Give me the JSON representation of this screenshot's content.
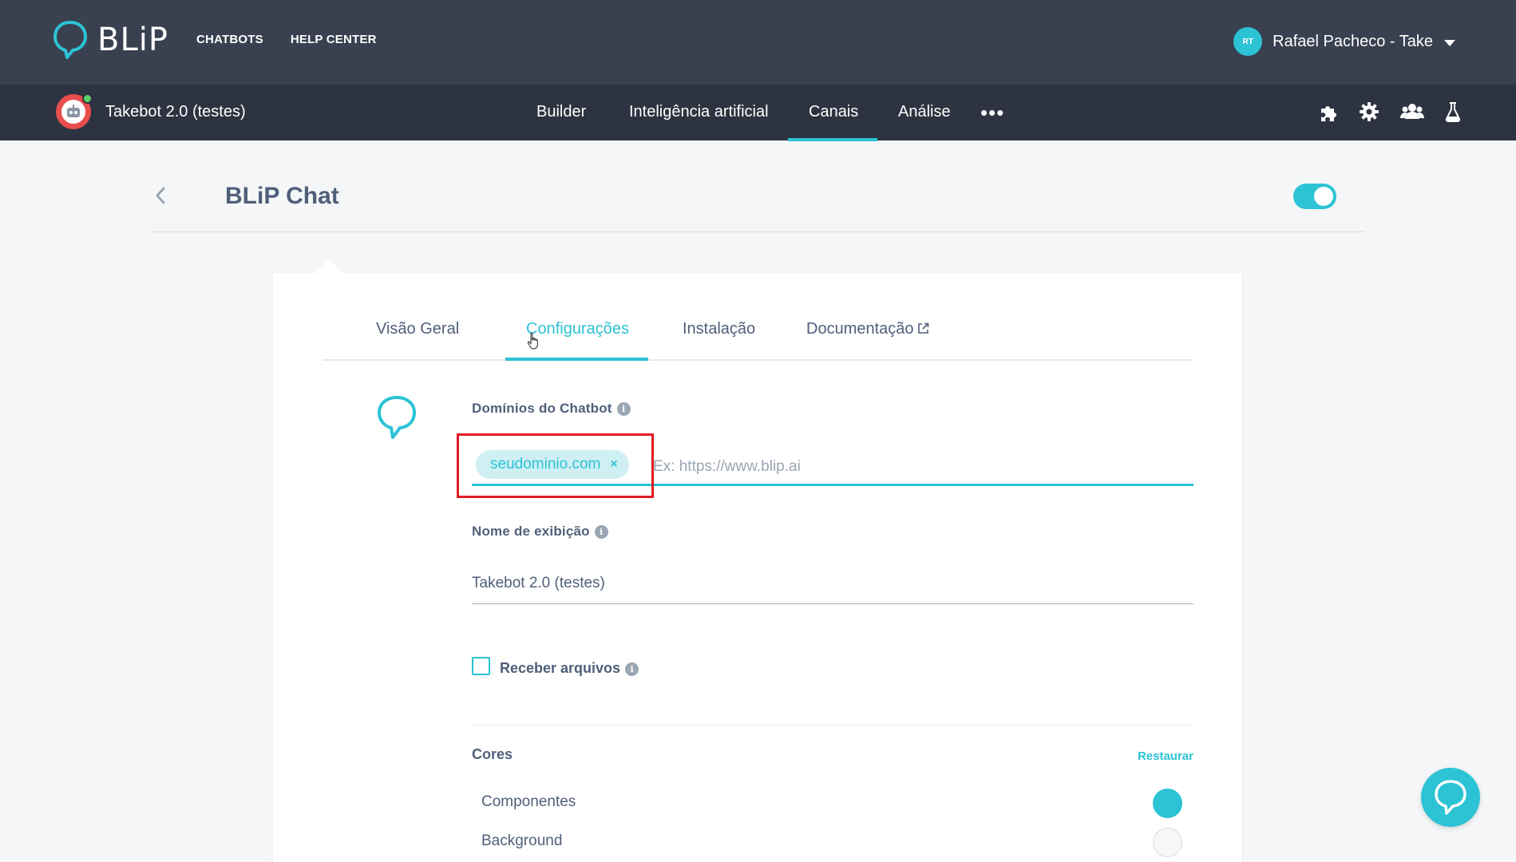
{
  "app": {
    "brand": "BLiP",
    "top_nav": [
      "CHATBOTS",
      "HELP CENTER"
    ],
    "user": {
      "initials": "RT",
      "name": "Rafael Pacheco - Take"
    }
  },
  "bot": {
    "name": "Takebot 2.0 (testes)",
    "tabs": [
      "Builder",
      "Inteligência artificial",
      "Canais",
      "Análise"
    ],
    "active_tab": "Canais",
    "more": "•••",
    "tool_icons": [
      "puzzle-icon",
      "gear-icon",
      "team-icon",
      "flask-icon"
    ]
  },
  "page": {
    "title": "BLiP Chat",
    "enabled": true
  },
  "card": {
    "tabs": [
      "Visão Geral",
      "Configurações",
      "Instalação",
      "Documentação"
    ],
    "active_tab": "Configurações",
    "domains": {
      "label": "Domínios do Chatbot",
      "chips": [
        "seudominio.com"
      ],
      "chip_remove": "×",
      "placeholder": "Ex: https://www.blip.ai"
    },
    "display_name": {
      "label": "Nome de exibição",
      "value": "Takebot 2.0 (testes)"
    },
    "receive_files": {
      "label": "Receber arquivos",
      "checked": false
    },
    "colors": {
      "label": "Cores",
      "reset": "Restaurar",
      "items": [
        {
          "label": "Componentes",
          "color": "#2cc3d5"
        },
        {
          "label": "Background",
          "color": "#f7f7f7"
        }
      ]
    }
  },
  "theme": {
    "accent": "#2cc3d5",
    "topbar": "#394150",
    "botbar": "#2d3340",
    "highlight": "#e21b23"
  }
}
